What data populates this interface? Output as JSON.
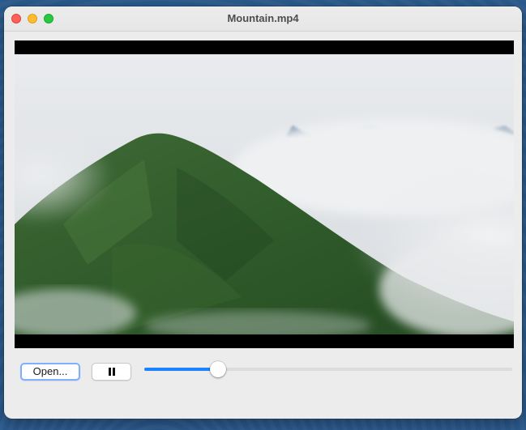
{
  "window": {
    "title": "Mountain.mp4"
  },
  "controls": {
    "open_label": "Open...",
    "pause_icon": "pause-icon",
    "progress_fraction": 0.2
  },
  "colors": {
    "accent": "#1a84ff",
    "close": "#fe5f57",
    "minimize": "#febc2e",
    "maximize": "#28c840"
  }
}
